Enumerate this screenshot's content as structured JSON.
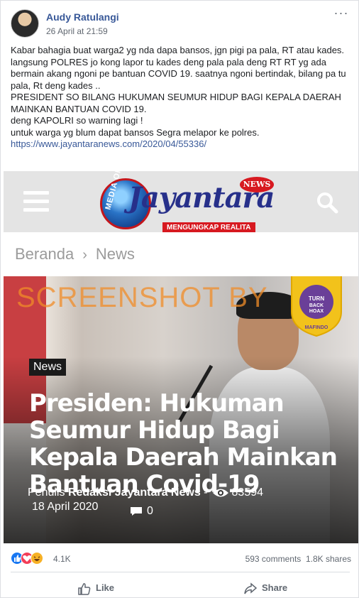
{
  "post": {
    "author": "Audy Ratulangi",
    "timestamp": "26 April at 21:59",
    "more_label": "···",
    "text_lines": [
      "Kabar bahagia buat warga2 yg nda dapa bansos, jgn pigi pa pala, RT atau kades. langsung POLRES jo kong lapor tu kades deng pala pala deng RT RT yg ada bermain akang ngoni pe bantuan COVID 19. saatnya ngoni bertindak, bilang pa tu pala, Rt deng kades ..",
      "PRESIDENT SO BILANG HUKUMAN SEUMUR HIDUP BAGI KEPALA DAERAH MAINKAN BANTUAN COVID 19.",
      "deng KAPOLRI so warning lagi !",
      "untuk warga yg blum dapat bansos Segra melapor ke polres."
    ],
    "link": "https://www.jayantaranews.com/2020/04/55336/"
  },
  "shared": {
    "logo_text": "Jayantara",
    "logo_arc_text": "MEDIA ON",
    "news_badge": "NEWS",
    "tagline": "MENGUNGKAP REALITA",
    "breadcrumb_home": "Beranda",
    "breadcrumb_sep": "›",
    "breadcrumb_current": "News",
    "watermark": "SCREENSHOT BY",
    "badge_top": "MASYARAKAT ANTI FITNAH INDONESIA",
    "badge_center": "TURN BACK HOAX",
    "badge_bottom": "MAFINDO",
    "category": "News",
    "headline": "Presiden: Hukuman Seumur Hidup Bagi Kepala Daerah Mainkan Bantuan Covid-19",
    "byline_prefix": "Penulis",
    "byline_author": "Redaksi Jayantara News",
    "byline_sep": "-",
    "views": "83594",
    "date": "18 April 2020",
    "comments": "0"
  },
  "footer": {
    "reaction_count": "4.1K",
    "comments": "593 comments",
    "shares": "1.8K shares",
    "like_label": "Like",
    "share_label": "Share"
  },
  "colors": {
    "link_blue": "#385898",
    "like_blue": "#1877f2",
    "love_red": "#f33e58",
    "haha_yellow": "#f7b125",
    "brand_red": "#d71920",
    "brand_navy": "#27308a"
  }
}
